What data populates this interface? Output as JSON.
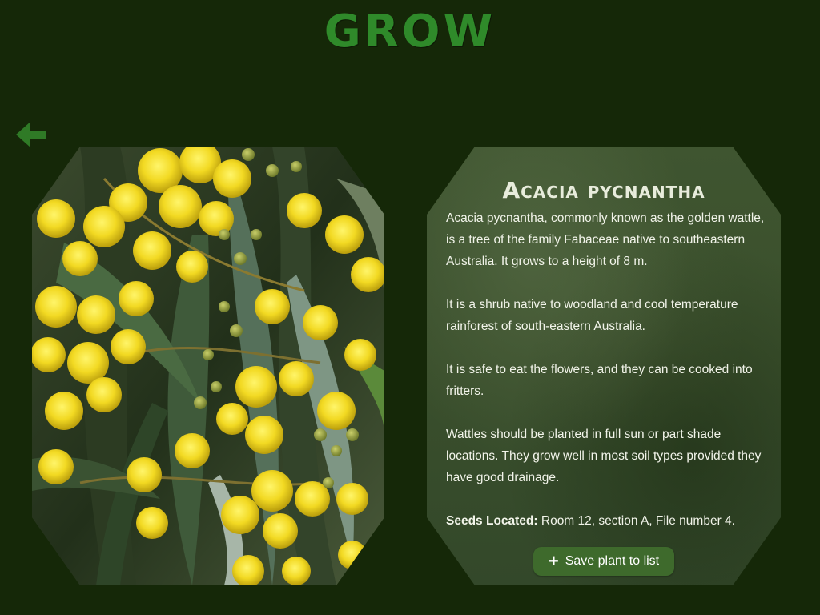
{
  "app": {
    "title": "GROW"
  },
  "navigation": {
    "back_icon": "arrow-left-icon"
  },
  "photo": {
    "subject": "yellow wattle blossoms"
  },
  "plant": {
    "name": "Acacia pycnantha",
    "paragraphs": [
      "Acacia pycnantha, commonly known as the golden wattle, is a tree of the family Fabaceae native to southeastern Australia. It grows to a height of 8 m.",
      "It is a shrub native to woodland and cool temperature rainforest of south-eastern Australia.",
      "It is safe to eat  the flowers, and they can be cooked into fritters.",
      "Wattles should be planted in full sun or part shade locations. They grow well in most soil types provided they have good drainage."
    ],
    "seeds_label": "Seeds Located:",
    "seeds_value": "Room 12, section A, File number 4."
  },
  "actions": {
    "save_icon": "plus-icon",
    "save_label": "Save plant to list"
  },
  "colors": {
    "background": "#152808",
    "title": "#2f8a2a",
    "accent": "#3e6a2c",
    "panel": "#3a4f2c"
  }
}
